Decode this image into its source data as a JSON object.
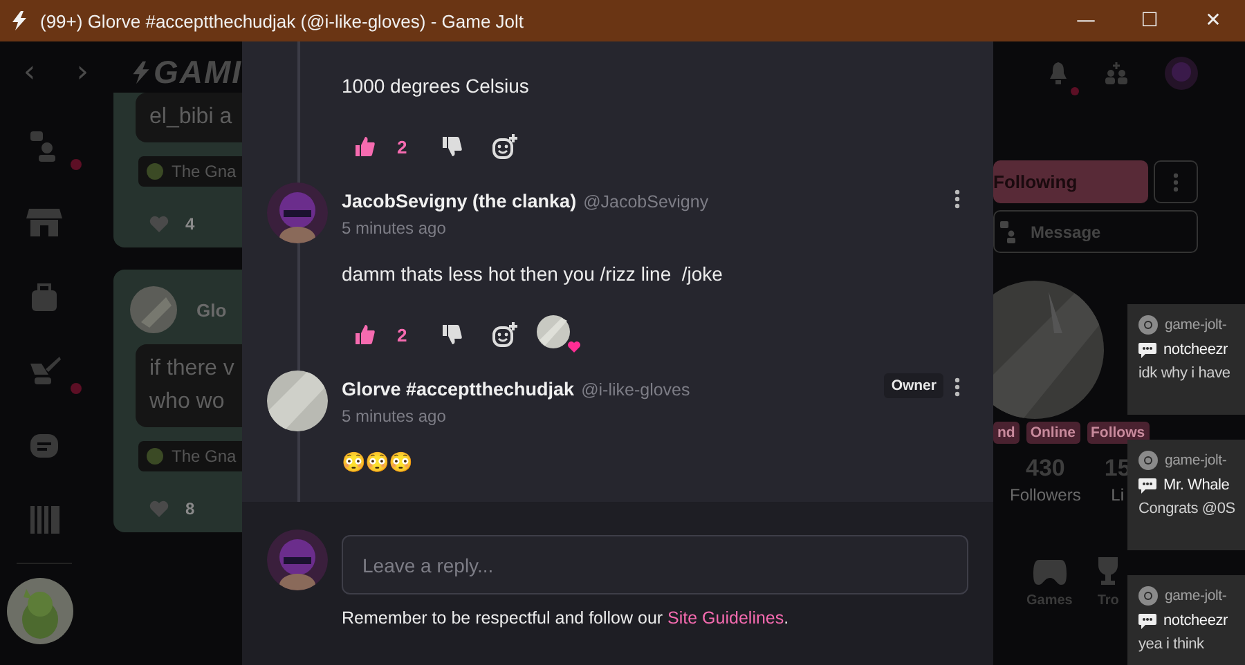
{
  "window": {
    "title": "(99+) Glorve #acceptthechudjak (@i-like-gloves) - Game Jolt",
    "controls": [
      "—",
      "☐",
      "✕"
    ]
  },
  "top_bar": {
    "back": "‹",
    "forward": "›",
    "logo": "GAMI"
  },
  "sidebar": {
    "items": [
      {
        "kind": "friends",
        "badge": true
      },
      {
        "kind": "store",
        "badge": false
      },
      {
        "kind": "bag",
        "badge": false
      },
      {
        "kind": "brush",
        "badge": true
      },
      {
        "kind": "robot",
        "badge": false
      },
      {
        "kind": "library",
        "badge": false
      }
    ]
  },
  "feed": {
    "cards": [
      {
        "text_lines": [
          "el_bibi a"
        ],
        "community": "The Gna",
        "likes": "4"
      },
      {
        "author": "Glo",
        "text_lines": [
          "if there v",
          "who wo"
        ],
        "community": "The Gna",
        "likes": "8"
      }
    ]
  },
  "comments": [
    {
      "text": "1000 degrees Celsius",
      "likes": "2",
      "liked": true
    },
    {
      "author": "JacobSevigny (the clanka)",
      "handle": "@JacobSevigny",
      "time": "5 minutes ago",
      "text": "damm thats less hot then you /rizz line  /joke",
      "likes": "2",
      "liked": true,
      "reactions": [
        {
          "kind": "heart"
        }
      ]
    },
    {
      "author": "Glorve #acceptthechudjak",
      "handle": "@i-like-gloves",
      "time": "5 minutes ago",
      "badge": "Owner",
      "text": "😳😳😳"
    }
  ],
  "reply": {
    "placeholder": "Leave a reply...",
    "note": "Remember to be respectful and follow our ",
    "link": "Site Guidelines",
    "note_end": "."
  },
  "profile": {
    "follow_button": "Following",
    "message_button": "Message",
    "tags": [
      "nd",
      "Online",
      "Follows"
    ],
    "stats": [
      {
        "value": "430",
        "label": "Followers"
      },
      {
        "value": "15",
        "label": "Li"
      }
    ],
    "tabs": [
      {
        "label": "Games",
        "kind": "games"
      },
      {
        "label": "Tro",
        "kind": "trophy"
      }
    ]
  },
  "notifications": [
    {
      "source": "game-jolt-",
      "author": "notcheezr",
      "message": "idk why i have"
    },
    {
      "source": "game-jolt-",
      "author": "Mr. Whale",
      "message": "Congrats @0S"
    },
    {
      "source": "game-jolt-",
      "author": "notcheezr",
      "message": "yea i think"
    }
  ]
}
